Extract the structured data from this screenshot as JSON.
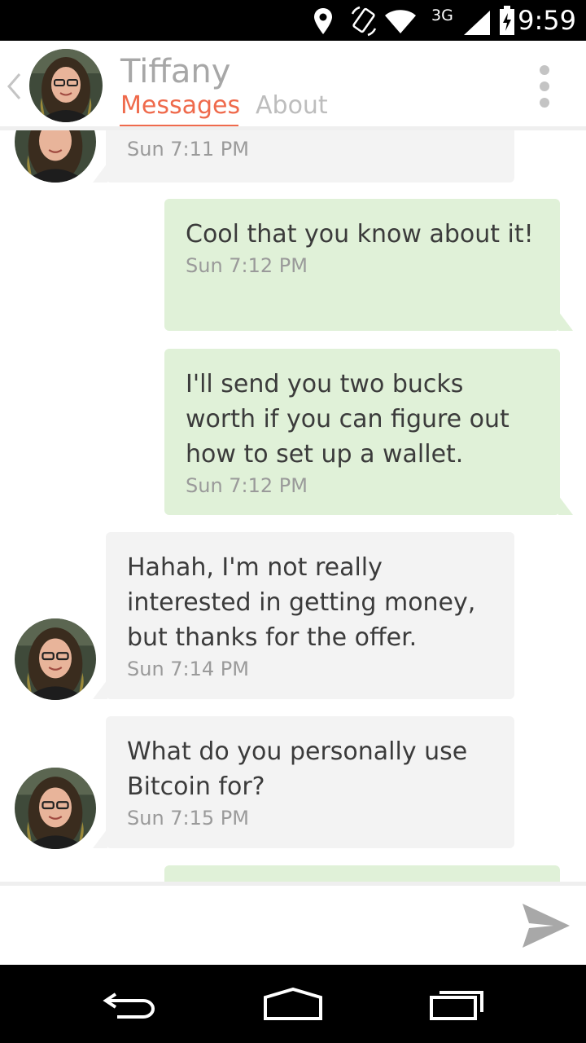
{
  "status_bar": {
    "network": "3G",
    "time": "9:59",
    "icons": [
      "location-icon",
      "rotate-icon",
      "wifi-icon",
      "signal-icon",
      "battery-icon"
    ]
  },
  "header": {
    "back_icon": "chevron-left-icon",
    "contact_name": "Tiffany",
    "tabs": [
      {
        "label": "Messages",
        "active": true
      },
      {
        "label": "About",
        "active": false
      }
    ],
    "menu_icon": "overflow-menu-icon"
  },
  "messages": [
    {
      "direction": "incoming",
      "text": "",
      "time": "Sun 7:11 PM"
    },
    {
      "direction": "outgoing",
      "text": "Cool that you know about it!",
      "time": "Sun 7:12 PM"
    },
    {
      "direction": "outgoing",
      "text": "I'll send you two bucks worth if you can figure out how to set up a wallet.",
      "time": "Sun 7:12 PM"
    },
    {
      "direction": "incoming",
      "text": "Hahah, I'm not really interested in getting money, but thanks for the offer.",
      "time": "Sun 7:14 PM"
    },
    {
      "direction": "incoming",
      "text": "What do you personally use Bitcoin for?",
      "time": "Sun 7:15 PM"
    },
    {
      "direction": "outgoing",
      "text": "",
      "time": ""
    }
  ],
  "compose": {
    "input_value": "",
    "send_icon": "send-icon"
  },
  "nav_bar": {
    "icons": [
      "back-nav-icon",
      "home-nav-icon",
      "recents-nav-icon"
    ]
  },
  "colors": {
    "accent": "#ef6a4c",
    "incoming_bubble": "#f3f3f3",
    "outgoing_bubble": "#e0f1d8",
    "title_gray": "#a7a7a7"
  }
}
